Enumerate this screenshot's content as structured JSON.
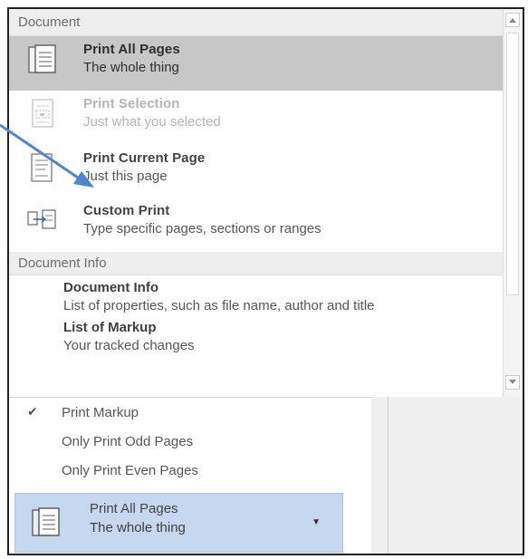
{
  "sections": {
    "document_header": "Document",
    "document_info_header": "Document Info"
  },
  "document_items": [
    {
      "title": "Print All Pages",
      "subtitle": "The whole thing",
      "icon": "print-all-pages-icon",
      "state": "selected"
    },
    {
      "title": "Print Selection",
      "subtitle": "Just what you selected",
      "icon": "print-selection-icon",
      "state": "disabled"
    },
    {
      "title": "Print Current Page",
      "subtitle": "Just this page",
      "icon": "print-current-page-icon",
      "state": "normal"
    },
    {
      "title": "Custom Print",
      "subtitle": "Type specific pages, sections or ranges",
      "icon": "custom-print-icon",
      "state": "normal"
    }
  ],
  "document_info_items": [
    {
      "title": "Document Info",
      "subtitle": "List of properties, such as file name, author and title"
    },
    {
      "title": "List of Markup",
      "subtitle": "Your tracked changes"
    }
  ],
  "options": [
    {
      "label": "Print Markup",
      "checked": true
    },
    {
      "label": "Only Print Odd Pages",
      "checked": false
    },
    {
      "label": "Only Print Even Pages",
      "checked": false
    }
  ],
  "bottom_button": {
    "title": "Print All Pages",
    "subtitle": "The whole thing",
    "icon": "print-all-pages-icon",
    "dropdown_icon": "chevron-down-icon"
  },
  "colors": {
    "selected_item_bg": "#c7c7c7",
    "button_bg": "#c5d8f0",
    "arrow": "#4a86d4"
  }
}
